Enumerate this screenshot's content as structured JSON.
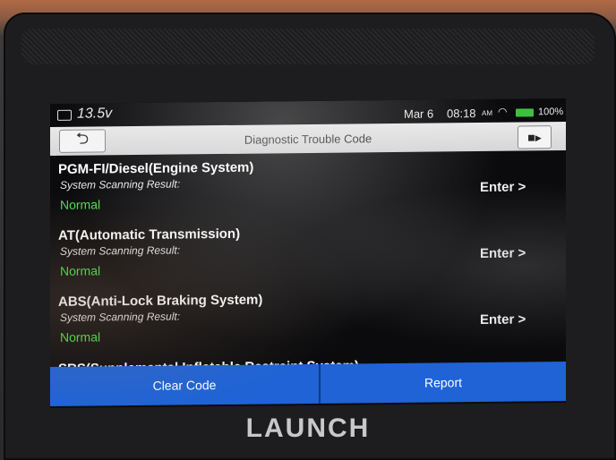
{
  "status_bar": {
    "voltage": "13.5v",
    "date": "Mar 6",
    "time": "08:18",
    "ampm": "AM",
    "battery_percent": "100%",
    "battery_level": 1.0
  },
  "title_bar": {
    "title": "Diagnostic Trouble Code",
    "back_icon": "back-arrow-icon",
    "exit_icon": "exit-door-icon"
  },
  "systems": [
    {
      "name": "PGM-FI/Diesel(Engine System)",
      "scan_label": "System Scanning Result:",
      "result": "Normal",
      "action": "Enter >"
    },
    {
      "name": "AT(Automatic Transmission)",
      "scan_label": "System Scanning Result:",
      "result": "Normal",
      "action": "Enter >"
    },
    {
      "name": "ABS(Anti-Lock Braking System)",
      "scan_label": "System Scanning Result:",
      "result": "Normal",
      "action": "Enter >"
    },
    {
      "name": "SRS(Supplemental Inflatable Restraint System)"
    }
  ],
  "buttons": {
    "clear_code": "Clear Code",
    "report": "Report"
  },
  "brand": "LAUNCH",
  "colors": {
    "accent_blue": "#1f63d6",
    "normal_green": "#4fdf4f",
    "titlebar_gray": "#dcdcdc"
  }
}
